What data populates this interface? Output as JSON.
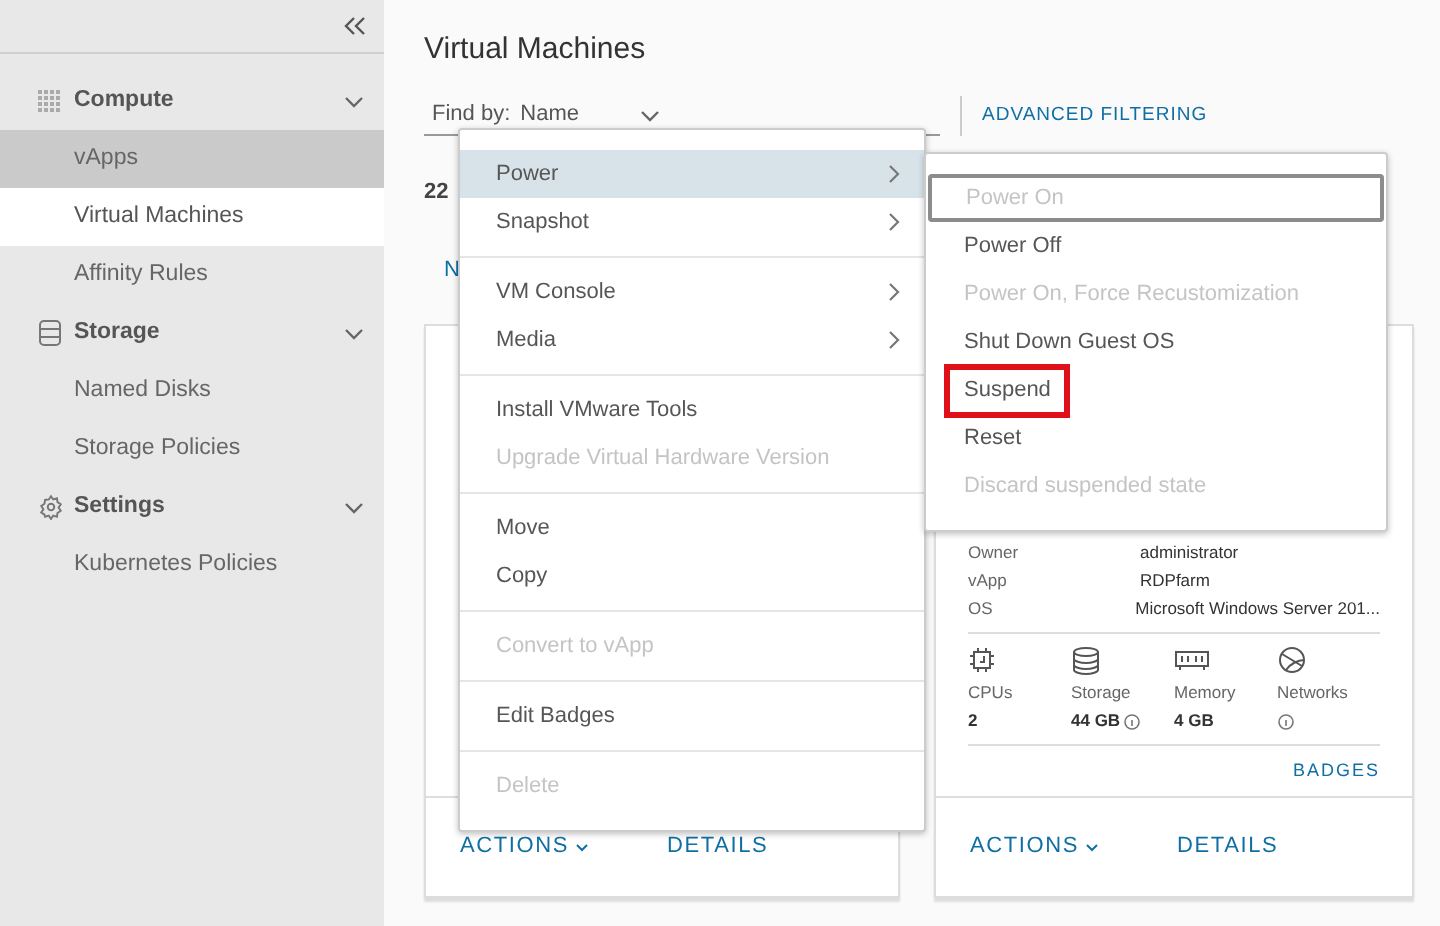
{
  "sidebar": {
    "groups": [
      {
        "label": "Compute",
        "expanded": true,
        "items": [
          {
            "label": "vApps",
            "selected": false,
            "hovered": true
          },
          {
            "label": "Virtual Machines",
            "selected": true,
            "hovered": false
          },
          {
            "label": "Affinity Rules",
            "selected": false,
            "hovered": false
          }
        ]
      },
      {
        "label": "Storage",
        "expanded": true,
        "items": [
          {
            "label": "Named Disks",
            "selected": false,
            "hovered": false
          },
          {
            "label": "Storage Policies",
            "selected": false,
            "hovered": false
          }
        ]
      },
      {
        "label": "Settings",
        "expanded": true,
        "items": [
          {
            "label": "Kubernetes Policies",
            "selected": false,
            "hovered": false
          }
        ]
      }
    ]
  },
  "page": {
    "title": "Virtual Machines",
    "find_by": {
      "label": "Find by:",
      "value": "Name"
    },
    "advanced_filtering": "ADVANCED FILTERING",
    "count": "22",
    "sort_link": "N"
  },
  "cards": [
    {
      "actions": "ACTIONS",
      "details_link": "DETAILS"
    },
    {
      "details": [
        {
          "key": "Owner",
          "value": "administrator"
        },
        {
          "key": "vApp",
          "value": "RDPfarm"
        },
        {
          "key": "OS",
          "value": "Microsoft Windows Server 201..."
        }
      ],
      "stats": [
        {
          "kind": "cpu",
          "label": "CPUs",
          "value": "2",
          "info": false
        },
        {
          "kind": "storage",
          "label": "Storage",
          "value": "44 GB",
          "info": true
        },
        {
          "kind": "memory",
          "label": "Memory",
          "value": "4 GB",
          "info": false
        },
        {
          "kind": "network",
          "label": "Networks",
          "info": true
        }
      ],
      "badges": "BADGES",
      "actions": "ACTIONS",
      "details_link": "DETAILS"
    }
  ],
  "actions_menu": {
    "groups": [
      [
        {
          "label": "Power",
          "submenu": true,
          "selected": true,
          "disabled": false
        },
        {
          "label": "Snapshot",
          "submenu": true,
          "selected": false,
          "disabled": false
        }
      ],
      [
        {
          "label": "VM Console",
          "submenu": true,
          "selected": false,
          "disabled": false
        },
        {
          "label": "Media",
          "submenu": true,
          "selected": false,
          "disabled": false
        }
      ],
      [
        {
          "label": "Install VMware Tools",
          "submenu": false,
          "selected": false,
          "disabled": false
        },
        {
          "label": "Upgrade Virtual Hardware Version",
          "submenu": false,
          "selected": false,
          "disabled": true
        }
      ],
      [
        {
          "label": "Move",
          "submenu": false,
          "selected": false,
          "disabled": false
        },
        {
          "label": "Copy",
          "submenu": false,
          "selected": false,
          "disabled": false
        }
      ],
      [
        {
          "label": "Convert to vApp",
          "submenu": false,
          "selected": false,
          "disabled": true
        }
      ],
      [
        {
          "label": "Edit Badges",
          "submenu": false,
          "selected": false,
          "disabled": false
        }
      ],
      [
        {
          "label": "Delete",
          "submenu": false,
          "selected": false,
          "disabled": true
        }
      ]
    ]
  },
  "power_submenu": {
    "items": [
      {
        "label": "Power On",
        "disabled": true,
        "focused": true,
        "highlighted": false
      },
      {
        "label": "Power Off",
        "disabled": false,
        "focused": false,
        "highlighted": false
      },
      {
        "label": "Power On, Force Recustomization",
        "disabled": true,
        "focused": false,
        "highlighted": false
      },
      {
        "label": "Shut Down Guest OS",
        "disabled": false,
        "focused": false,
        "highlighted": false
      },
      {
        "label": "Suspend",
        "disabled": false,
        "focused": false,
        "highlighted": true
      },
      {
        "label": "Reset",
        "disabled": false,
        "focused": false,
        "highlighted": false
      },
      {
        "label": "Discard suspended state",
        "disabled": true,
        "focused": false,
        "highlighted": false
      }
    ]
  }
}
